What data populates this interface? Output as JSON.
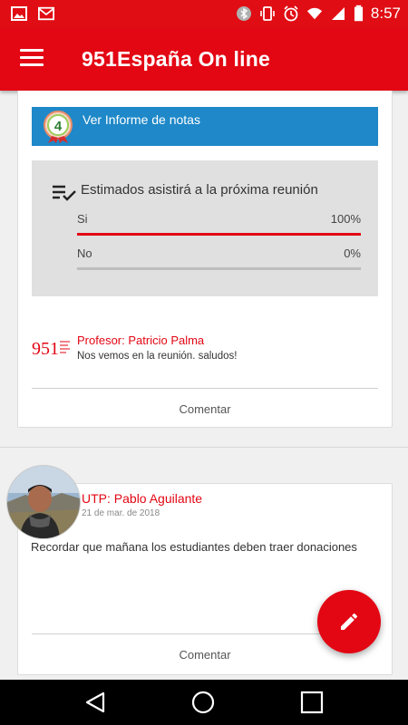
{
  "status_bar": {
    "time": "8:57",
    "left_icons": [
      "image-icon",
      "mail-icon"
    ],
    "right_icons": [
      "bluetooth-icon",
      "vibrate-icon",
      "alarm-icon",
      "wifi-icon",
      "signal-icon",
      "battery-icon"
    ]
  },
  "app_bar": {
    "title": "951España On line",
    "menu_icon": "hamburger-menu-icon",
    "color": "#e30613"
  },
  "post1": {
    "banner_text": "Ver Informe de notas",
    "banner_color": "#1e88c8",
    "badge_number": "4",
    "poll": {
      "question": "Estimados  asistirá a la próxima reunión",
      "options": [
        {
          "label": "Si",
          "percent": "100%",
          "fraction": 1.0
        },
        {
          "label": "No",
          "percent": "0%",
          "fraction": 0.0
        }
      ]
    },
    "teacher": {
      "logo": "951",
      "name": "Profesor: Patricio Palma",
      "message": "Nos vemos en la reunión. saludos!"
    },
    "comment_label": "Comentar"
  },
  "post2": {
    "author": "UTP: Pablo Aguilante",
    "date": "21 de mar. de 2018",
    "text": "Recordar que mañana los estudiantes deben traer donaciones",
    "comment_label": "Comentar"
  },
  "fab": {
    "icon": "pencil-icon"
  },
  "nav_bar": {
    "buttons": [
      "back-icon",
      "home-icon",
      "recents-icon"
    ]
  }
}
